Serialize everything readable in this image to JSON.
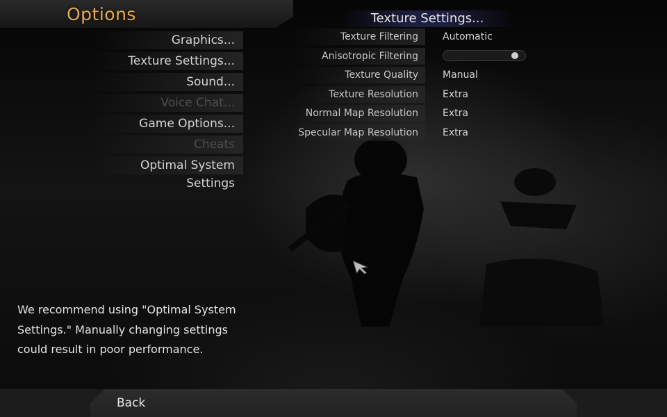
{
  "header": {
    "title": "Options"
  },
  "menu": {
    "items": [
      {
        "label": "Graphics...",
        "enabled": true
      },
      {
        "label": "Texture Settings...",
        "enabled": true
      },
      {
        "label": "Sound...",
        "enabled": true
      },
      {
        "label": "Voice Chat...",
        "enabled": false
      },
      {
        "label": "Game Options...",
        "enabled": true
      },
      {
        "label": "Cheats",
        "enabled": false
      },
      {
        "label": "Optimal System Settings",
        "enabled": true
      }
    ]
  },
  "texture_settings": {
    "title": "Texture Settings...",
    "rows": [
      {
        "label": "Texture Filtering",
        "value": "Automatic"
      },
      {
        "label": "Anisotropic Filtering",
        "slider_level": 0.92
      },
      {
        "label": "Texture Quality",
        "value": "Manual"
      },
      {
        "label": "Texture Resolution",
        "value": "Extra"
      },
      {
        "label": "Normal Map Resolution",
        "value": "Extra"
      },
      {
        "label": "Specular Map Resolution",
        "value": "Extra"
      }
    ]
  },
  "advice": {
    "lines": [
      "We recommend using \"Optimal System",
      "Settings.\"  Manually changing settings",
      "could result in poor performance."
    ]
  },
  "footer": {
    "back_label": "Back"
  },
  "colors": {
    "title": "#e8a84e",
    "disabled_text": "#4e4e4e"
  }
}
